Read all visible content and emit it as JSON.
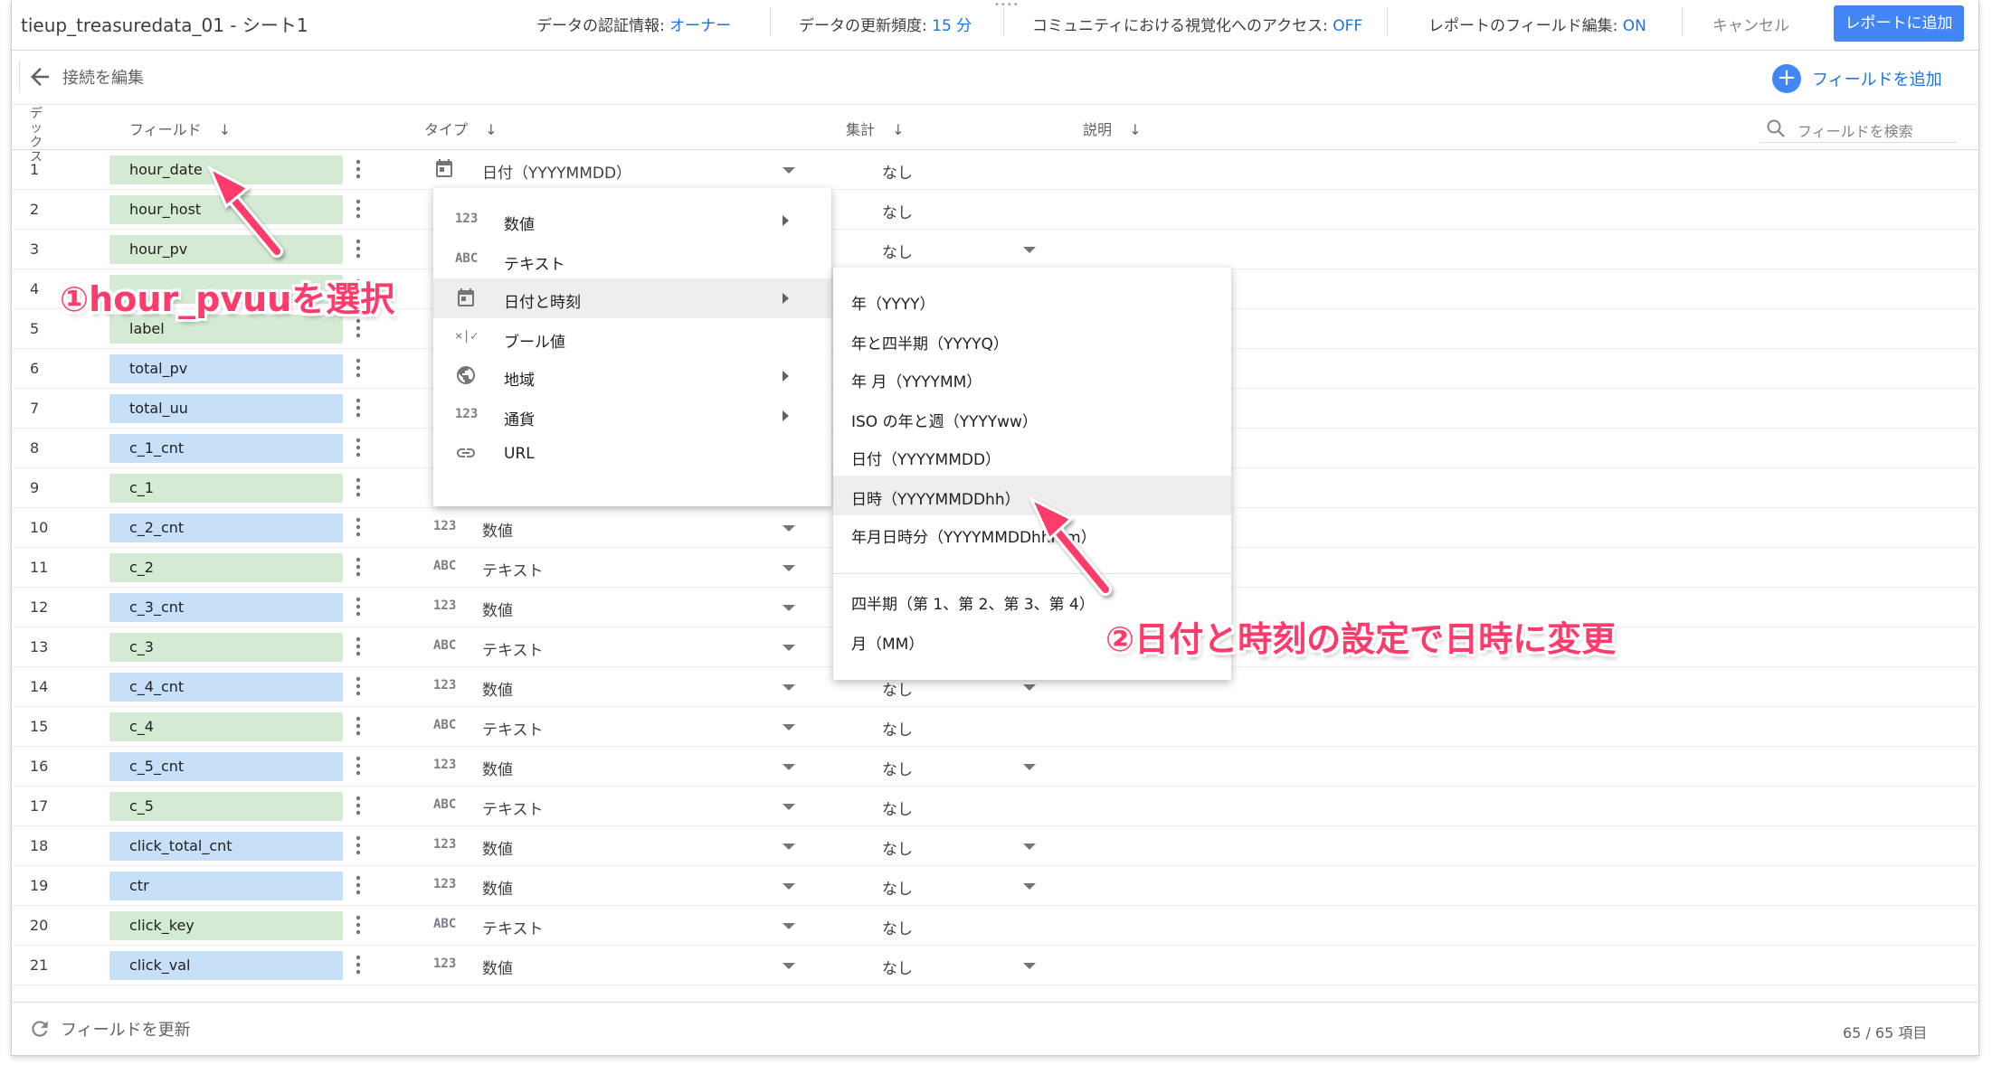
{
  "header": {
    "title": "tieup_treasuredata_01 - シート1",
    "credential_label": "データの認証情報:",
    "credential_value": "オーナー",
    "freshness_label": "データの更新頻度:",
    "freshness_value": "15 分",
    "community_label": "コミュニティにおける視覚化へのアクセス:",
    "community_value": "OFF",
    "field_edit_label": "レポートのフィールド編集:",
    "field_edit_value": "ON",
    "cancel_label": "キャンセル",
    "add_to_report_label": "レポートに追加"
  },
  "subbar": {
    "edit_connection_label": "接続を編集",
    "add_field_label": "フィールドを追加"
  },
  "columns": {
    "index": "デックス",
    "field": "フィールド",
    "type": "タイプ",
    "aggregation": "集計",
    "description": "説明",
    "search_placeholder": "フィールドを検索"
  },
  "rows": [
    {
      "num": "1",
      "name": "hour_date",
      "kind": "dim",
      "type_icon": "calendar",
      "type": "日付（YYYYMMDD）",
      "agg": "なし",
      "agg_caret": false
    },
    {
      "num": "2",
      "name": "hour_host",
      "kind": "dim",
      "type_icon": "",
      "type": "",
      "agg": "なし",
      "agg_caret": false
    },
    {
      "num": "3",
      "name": "hour_pv",
      "kind": "dim",
      "type_icon": "",
      "type": "",
      "agg": "なし",
      "agg_caret": true
    },
    {
      "num": "4",
      "name": "",
      "kind": "dim",
      "type_icon": "",
      "type": "",
      "agg": "",
      "agg_caret": false
    },
    {
      "num": "5",
      "name": "label",
      "kind": "dim",
      "type_icon": "",
      "type": "",
      "agg": "",
      "agg_caret": false
    },
    {
      "num": "6",
      "name": "total_pv",
      "kind": "met",
      "type_icon": "",
      "type": "",
      "agg": "",
      "agg_caret": false
    },
    {
      "num": "7",
      "name": "total_uu",
      "kind": "met",
      "type_icon": "",
      "type": "",
      "agg": "",
      "agg_caret": false
    },
    {
      "num": "8",
      "name": "c_1_cnt",
      "kind": "met",
      "type_icon": "",
      "type": "",
      "agg": "",
      "agg_caret": false
    },
    {
      "num": "9",
      "name": "c_1",
      "kind": "dim",
      "type_icon": "",
      "type": "",
      "agg": "",
      "agg_caret": false
    },
    {
      "num": "10",
      "name": "c_2_cnt",
      "kind": "met",
      "type_icon": "123",
      "type": "数値",
      "agg": "",
      "agg_caret": false
    },
    {
      "num": "11",
      "name": "c_2",
      "kind": "dim",
      "type_icon": "ABC",
      "type": "テキスト",
      "agg": "",
      "agg_caret": false
    },
    {
      "num": "12",
      "name": "c_3_cnt",
      "kind": "met",
      "type_icon": "123",
      "type": "数値",
      "agg": "",
      "agg_caret": false
    },
    {
      "num": "13",
      "name": "c_3",
      "kind": "dim",
      "type_icon": "ABC",
      "type": "テキスト",
      "agg": "",
      "agg_caret": false
    },
    {
      "num": "14",
      "name": "c_4_cnt",
      "kind": "met",
      "type_icon": "123",
      "type": "数値",
      "agg": "なし",
      "agg_caret": true
    },
    {
      "num": "15",
      "name": "c_4",
      "kind": "dim",
      "type_icon": "ABC",
      "type": "テキスト",
      "agg": "なし",
      "agg_caret": false
    },
    {
      "num": "16",
      "name": "c_5_cnt",
      "kind": "met",
      "type_icon": "123",
      "type": "数値",
      "agg": "なし",
      "agg_caret": true
    },
    {
      "num": "17",
      "name": "c_5",
      "kind": "dim",
      "type_icon": "ABC",
      "type": "テキスト",
      "agg": "なし",
      "agg_caret": false
    },
    {
      "num": "18",
      "name": "click_total_cnt",
      "kind": "met",
      "type_icon": "123",
      "type": "数値",
      "agg": "なし",
      "agg_caret": true
    },
    {
      "num": "19",
      "name": "ctr",
      "kind": "met",
      "type_icon": "123",
      "type": "数値",
      "agg": "なし",
      "agg_caret": true
    },
    {
      "num": "20",
      "name": "click_key",
      "kind": "dim",
      "type_icon": "ABC",
      "type": "テキスト",
      "agg": "なし",
      "agg_caret": false
    },
    {
      "num": "21",
      "name": "click_val",
      "kind": "met",
      "type_icon": "123",
      "type": "数値",
      "agg": "なし",
      "agg_caret": true
    }
  ],
  "type_menu": [
    {
      "icon": "123",
      "label": "数値",
      "submenu": true
    },
    {
      "icon": "ABC",
      "label": "テキスト",
      "submenu": false
    },
    {
      "icon": "calendar",
      "label": "日付と時刻",
      "submenu": true,
      "active": true
    },
    {
      "icon": "boolean",
      "label": "ブール値",
      "submenu": false
    },
    {
      "icon": "globe",
      "label": "地域",
      "submenu": true
    },
    {
      "icon": "123",
      "label": "通貨",
      "submenu": true
    },
    {
      "icon": "link",
      "label": "URL",
      "submenu": false
    }
  ],
  "date_menu": [
    {
      "label": "年（YYYY）"
    },
    {
      "label": "年と四半期（YYYYQ）"
    },
    {
      "label": "年 月（YYYYMM）"
    },
    {
      "label": "ISO の年と週（YYYYww）"
    },
    {
      "label": "日付（YYYYMMDD）"
    },
    {
      "label": "日時（YYYYMMDDhh）",
      "active": true
    },
    {
      "label": "年月日時分（YYYYMMDDhhmm）"
    },
    {
      "label": "四半期（第 1、第 2、第 3、第 4）"
    },
    {
      "label": "月（MM）"
    }
  ],
  "footer": {
    "refresh_label": "フィールドを更新",
    "count": "65 / 65 項目"
  },
  "annotations": {
    "step1": "①hour_pvuuを選択",
    "step2": "②日付と時刻の設定で日時に変更"
  },
  "colors": {
    "accent": "#4285f4",
    "dimension_chip": "#d5ead3",
    "metric_chip": "#c7e0f8",
    "annotation": "#ff3b6b"
  }
}
